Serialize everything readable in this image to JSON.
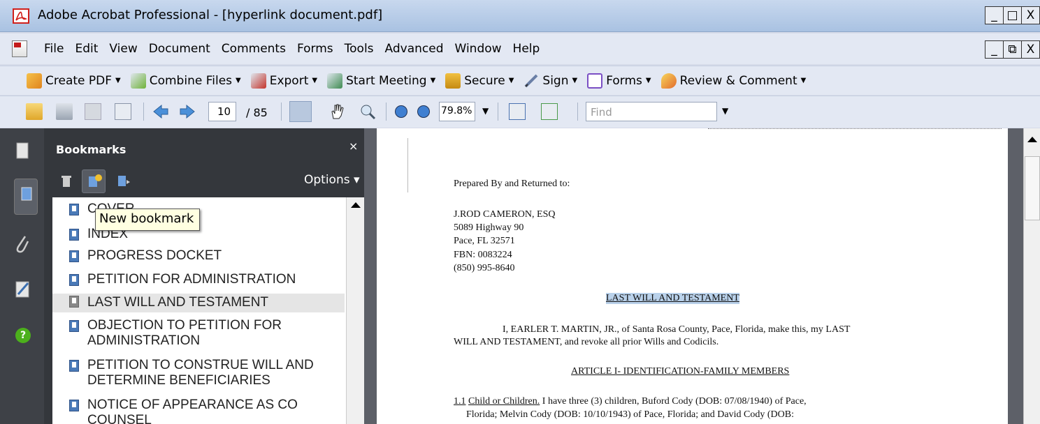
{
  "window": {
    "title": "Adobe Acrobat Professional - [hyperlink document.pdf]",
    "min_glyph": "_",
    "max_glyph": "□",
    "close_glyph": "X",
    "restore_glyph": "⧉"
  },
  "menu": [
    "File",
    "Edit",
    "View",
    "Document",
    "Comments",
    "Forms",
    "Tools",
    "Advanced",
    "Window",
    "Help"
  ],
  "tasks": [
    {
      "label": "Create PDF",
      "icon": "create-pdf-icon"
    },
    {
      "label": "Combine Files",
      "icon": "combine-files-icon"
    },
    {
      "label": "Export",
      "icon": "export-icon"
    },
    {
      "label": "Start Meeting",
      "icon": "start-meeting-icon"
    },
    {
      "label": "Secure",
      "icon": "lock-icon"
    },
    {
      "label": "Sign",
      "icon": "pen-icon"
    },
    {
      "label": "Forms",
      "icon": "forms-icon"
    },
    {
      "label": "Review & Comment",
      "icon": "review-comment-icon"
    }
  ],
  "toolbar": {
    "page_current": "10",
    "page_total": "/ 85",
    "zoom": "79.8%",
    "find_placeholder": "Find"
  },
  "bookmarks": {
    "title": "Bookmarks",
    "close": "×",
    "options": "Options ▾",
    "tooltip": "New bookmark",
    "items": [
      {
        "label": "COVER"
      },
      {
        "label": "INDEX"
      },
      {
        "label": "PROGRESS DOCKET"
      },
      {
        "label": "PETITION FOR ADMINISTRATION"
      },
      {
        "label": "LAST WILL AND TESTAMENT"
      },
      {
        "label": "OBJECTION TO PETITION FOR",
        "label2": "ADMINISTRATION"
      },
      {
        "label": "PETITION TO CONSTRUE WILL AND",
        "label2": "DETERMINE BENEFICIARIES"
      },
      {
        "label": "NOTICE OF APPEARANCE AS CO",
        "label2": "COUNSEL"
      }
    ]
  },
  "document": {
    "prepared": "Prepared By and Returned to:",
    "attorney": "J.ROD CAMERON, ESQ",
    "addr1": "5089 Highway 90",
    "addr2": "Pace, FL 32571",
    "fbn": "FBN: 0083224",
    "phone": "(850) 995-8640",
    "heading": "LAST WILL AND TESTAMENT",
    "para1a": "I, EARLER T. MARTIN, JR., of Santa Rosa County, Pace, Florida, make this, my LAST",
    "para1b": "WILL AND TESTAMENT, and revoke all prior Wills and Codicils.",
    "article": "ARTICLE I- IDENTIFICATION-FAMILY MEMBERS",
    "s11num": "1.1",
    "s11title": "Child or Children.",
    "s11a": " I have three (3) children, Buford Cody (DOB: 07/08/1940) of Pace,",
    "s11b": "Florida; Melvin Cody (DOB: 10/10/1943) of Pace, Florida; and David Cody (DOB:"
  }
}
